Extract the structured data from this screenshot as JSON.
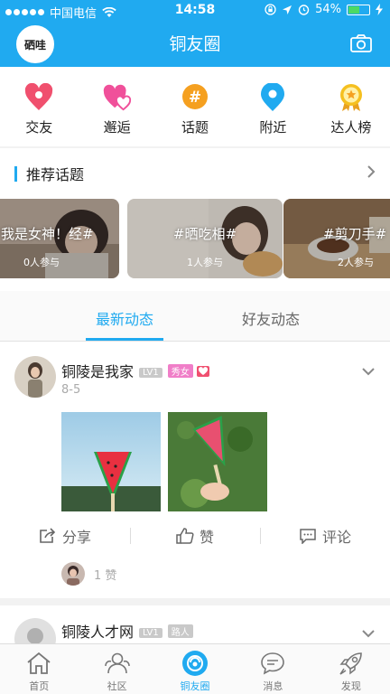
{
  "status": {
    "carrier": "中国电信",
    "time": "14:58",
    "battery": "54%",
    "battery_level": 0.54
  },
  "nav": {
    "title": "铜友圈",
    "logo_text": "硒哇"
  },
  "categories": [
    {
      "label": "交友",
      "icon": "heart-pin-icon",
      "color": "#f0506e"
    },
    {
      "label": "邂逅",
      "icon": "double-heart-icon",
      "color": "#f0509a"
    },
    {
      "label": "话题",
      "icon": "hash-icon",
      "color": "#f5a020"
    },
    {
      "label": "附近",
      "icon": "location-pin-icon",
      "color": "#20aaf0"
    },
    {
      "label": "达人榜",
      "icon": "medal-icon",
      "color": "#f5c020"
    }
  ],
  "recommended": {
    "title": "推荐话题",
    "topics": [
      {
        "title": "#我是女神！经#",
        "count": "0人参与"
      },
      {
        "title": "#晒吃相#",
        "count": "1人参与"
      },
      {
        "title": "#剪刀手#",
        "count": "2人参与"
      }
    ]
  },
  "tabs": {
    "latest": "最新动态",
    "friends": "好友动态"
  },
  "posts": [
    {
      "user": "铜陵是我家",
      "level": "LV1",
      "tag": "秀女",
      "date": "8-5",
      "actions": {
        "share": "分享",
        "like": "赞",
        "comment": "评论"
      },
      "likes": "1 赞"
    },
    {
      "user": "铜陵人才网",
      "level": "LV1",
      "tag": "路人"
    }
  ],
  "tabbar": [
    {
      "label": "首页",
      "icon": "home-icon"
    },
    {
      "label": "社区",
      "icon": "community-icon"
    },
    {
      "label": "铜友圈",
      "icon": "circle-icon"
    },
    {
      "label": "消息",
      "icon": "message-icon"
    },
    {
      "label": "发现",
      "icon": "rocket-icon"
    }
  ],
  "colors": {
    "accent": "#20aaf0",
    "level_badge": "#c9c9c9",
    "tag_pink": "#f07ec8"
  }
}
